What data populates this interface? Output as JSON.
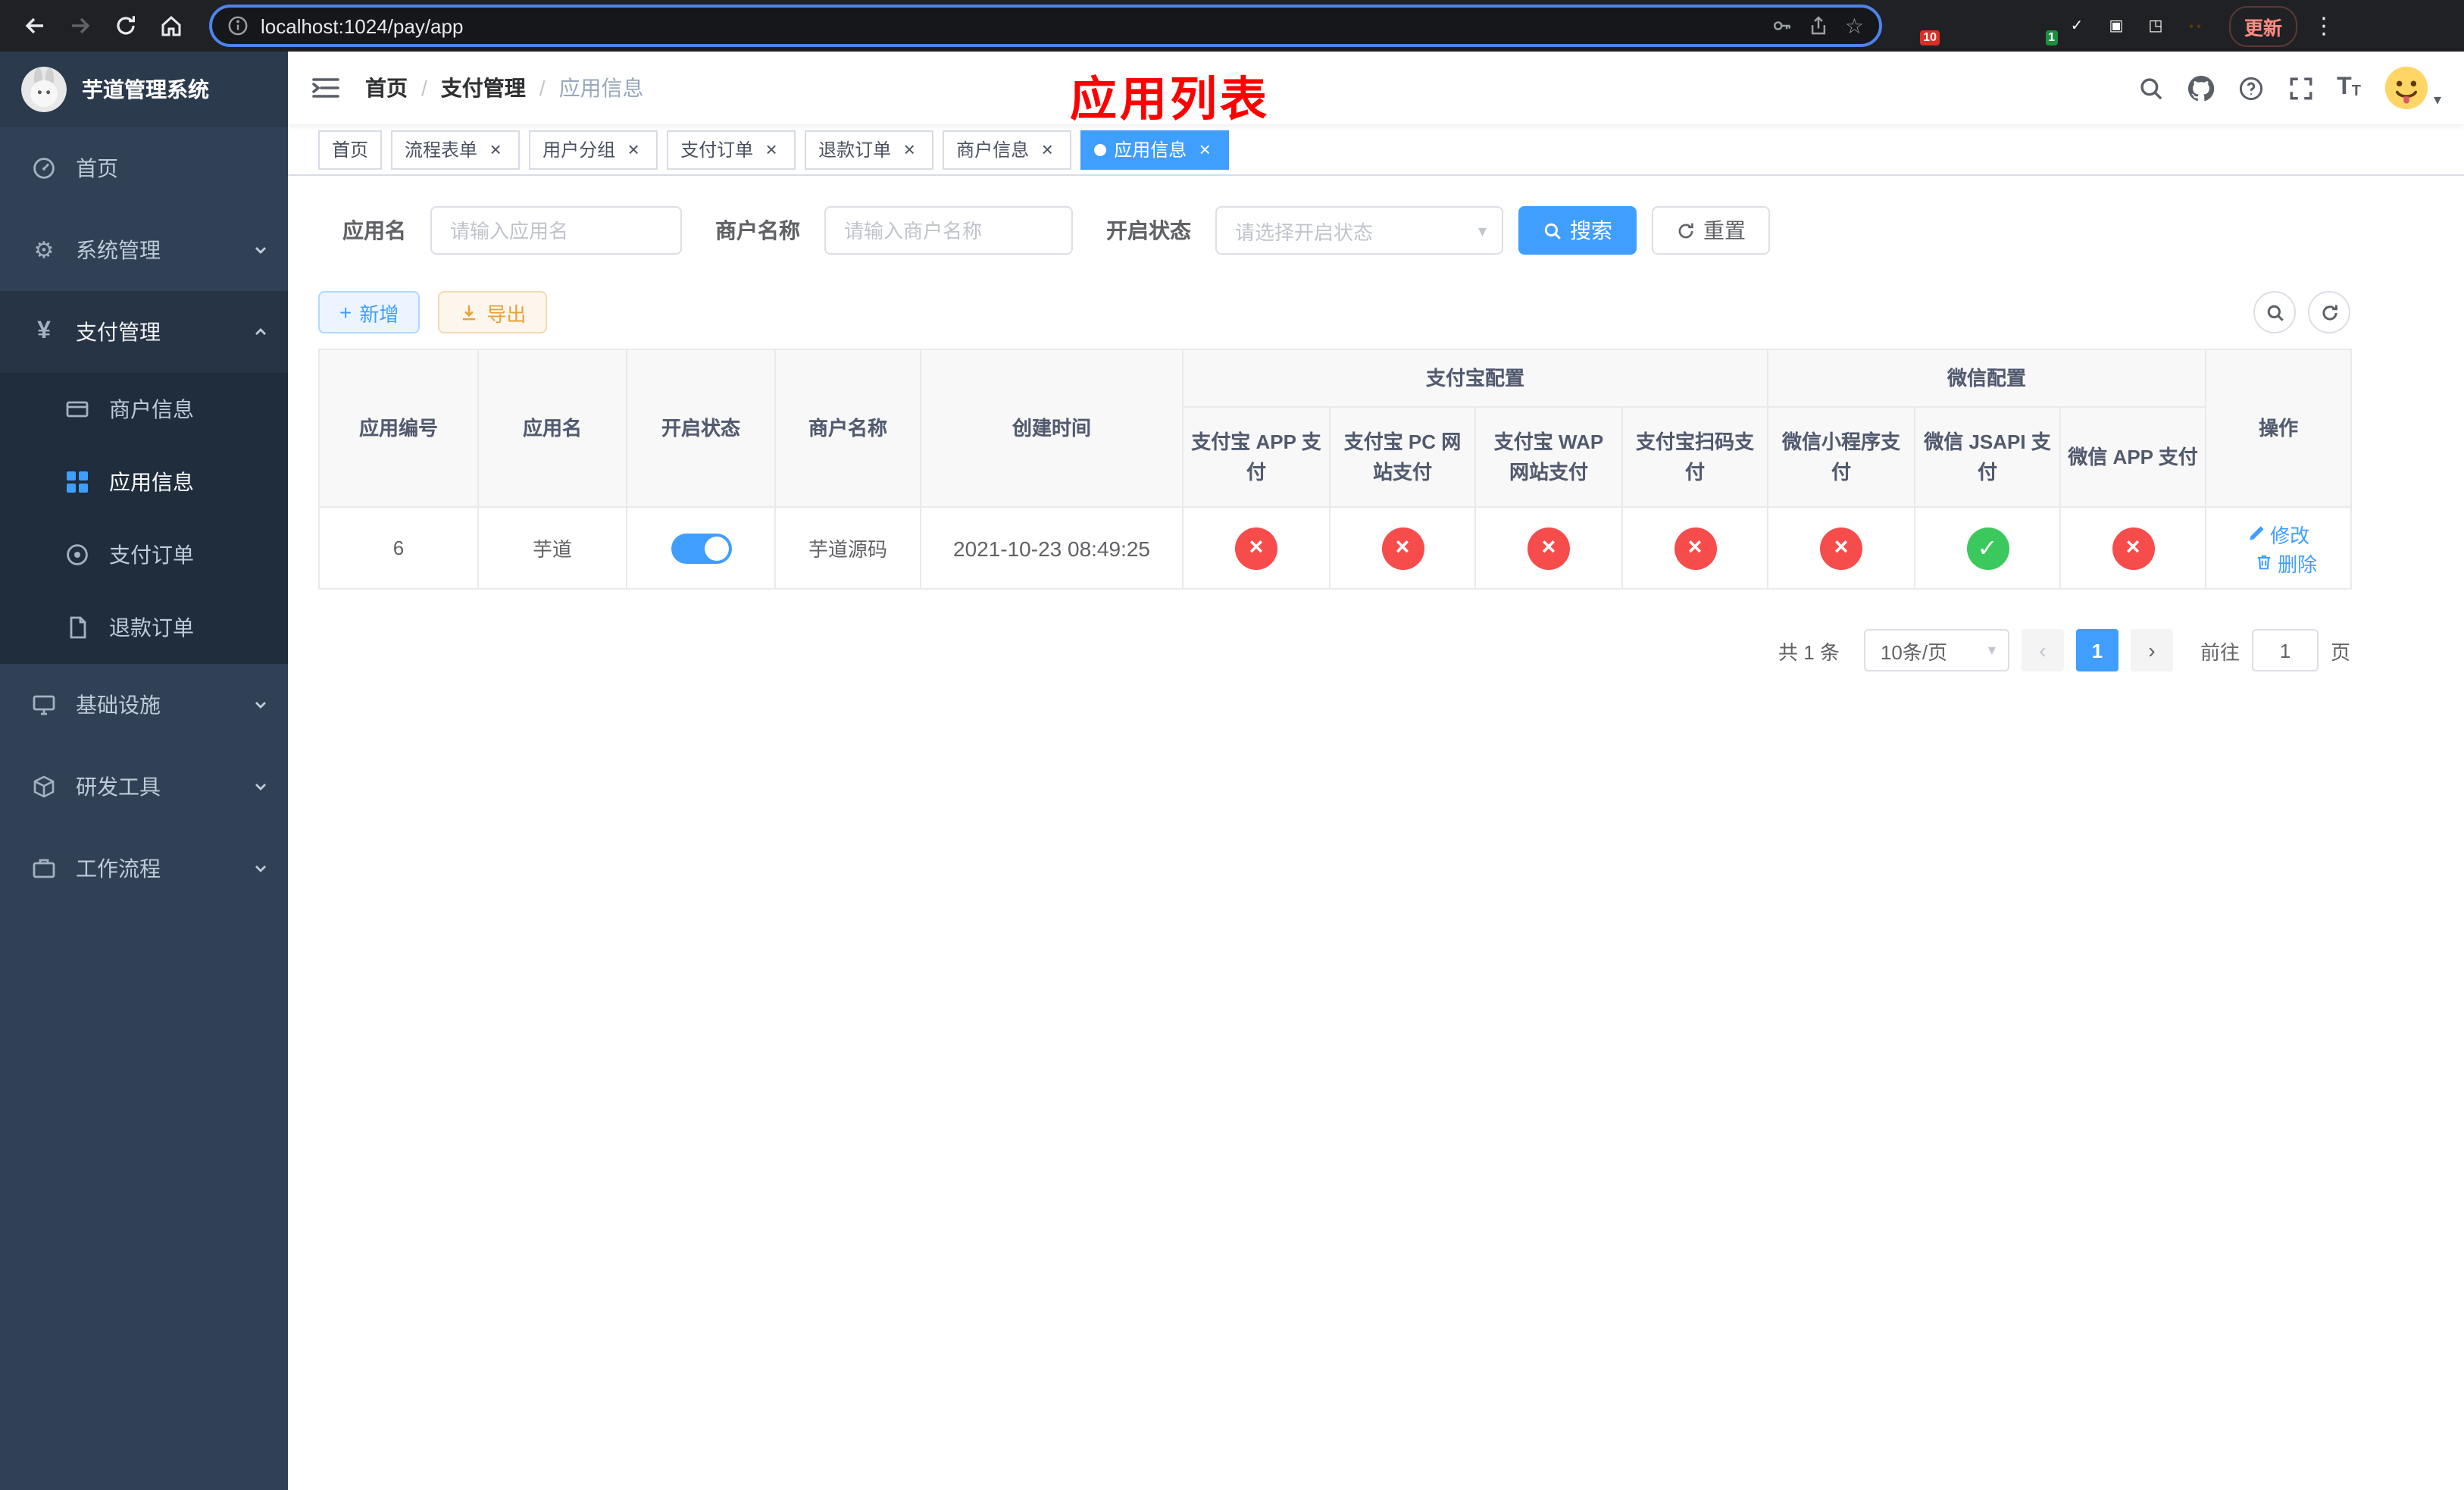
{
  "colors": {
    "accent": "#409eff",
    "danger": "#f64c4c",
    "success": "#3bc85c",
    "sidebar_bg": "#304156",
    "annotation_red": "#ff0000"
  },
  "browser": {
    "url": "localhost:1024/pay/app",
    "update_label": "更新",
    "extension_badges": {
      "first": "10",
      "second": "1"
    }
  },
  "sidebar": {
    "logo_title": "芋道管理系统",
    "items": [
      {
        "label": "首页"
      },
      {
        "label": "系统管理"
      },
      {
        "label": "支付管理"
      },
      {
        "label": "基础设施"
      },
      {
        "label": "研发工具"
      },
      {
        "label": "工作流程"
      }
    ],
    "sub_items": [
      {
        "label": "商户信息"
      },
      {
        "label": "应用信息"
      },
      {
        "label": "支付订单"
      },
      {
        "label": "退款订单"
      }
    ]
  },
  "header": {
    "breadcrumb": [
      {
        "label": "首页"
      },
      {
        "label": "支付管理"
      },
      {
        "label": "应用信息"
      }
    ],
    "annotation": "应用列表"
  },
  "tabs": [
    {
      "label": "首页"
    },
    {
      "label": "流程表单"
    },
    {
      "label": "用户分组"
    },
    {
      "label": "支付订单"
    },
    {
      "label": "退款订单"
    },
    {
      "label": "商户信息"
    },
    {
      "label": "应用信息"
    }
  ],
  "filters": {
    "app_name": {
      "label": "应用名",
      "placeholder": "请输入应用名",
      "value": ""
    },
    "merchant_name": {
      "label": "商户名称",
      "placeholder": "请输入商户名称",
      "value": ""
    },
    "status": {
      "label": "开启状态",
      "placeholder": "请选择开启状态",
      "value": ""
    },
    "search_label": "搜索",
    "reset_label": "重置"
  },
  "toolbar": {
    "add_label": "新增",
    "export_label": "导出"
  },
  "table": {
    "columns": {
      "app_id": "应用编号",
      "app_name": "应用名",
      "status": "开启状态",
      "merchant": "商户名称",
      "created": "创建时间",
      "alipay_group": "支付宝配置",
      "alipay_cols": [
        "支付宝 APP 支付",
        "支付宝 PC 网站支付",
        "支付宝 WAP 网站支付",
        "支付宝扫码支付"
      ],
      "wechat_group": "微信配置",
      "wechat_cols": [
        "微信小程序支付",
        "微信 JSAPI 支付",
        "微信 APP 支付"
      ],
      "actions": "操作"
    },
    "rows": [
      {
        "app_id": "6",
        "app_name": "芋道",
        "enabled": true,
        "merchant": "芋道源码",
        "created": "2021-10-23 08:49:25",
        "channels": [
          false,
          false,
          false,
          false,
          false,
          true,
          false
        ],
        "edit_label": "修改",
        "delete_label": "删除"
      }
    ]
  },
  "pagination": {
    "total": "共 1 条",
    "page_size": "10条/页",
    "page": "1",
    "goto_label": "前往",
    "goto_value": "1",
    "unit": "页"
  }
}
